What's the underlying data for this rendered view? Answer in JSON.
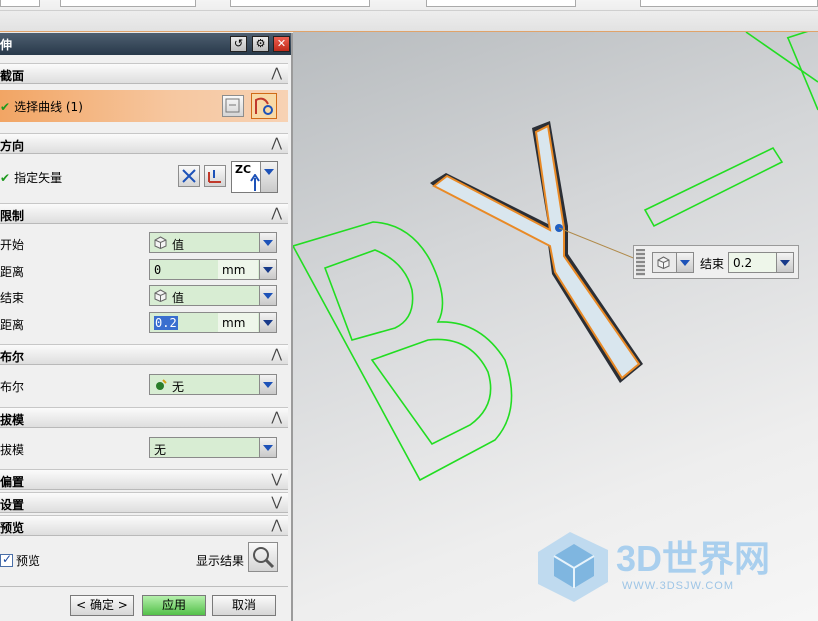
{
  "dialog": {
    "title": "伸",
    "sections": {
      "curve": {
        "label": "截面",
        "select_curve_label": "选择曲线 (1)"
      },
      "direction": {
        "label": "方向",
        "specify_vector_label": "指定矢量",
        "vector_option": "ZC"
      },
      "limits": {
        "label": "限制",
        "start_label": "开始",
        "start_value": "值",
        "start_distance_label": "距离",
        "start_distance": "0",
        "end_label": "结束",
        "end_value": "值",
        "end_distance_label": "距离",
        "end_distance": "0.2",
        "unit": "mm"
      },
      "boolean": {
        "label": "布尔",
        "field_label": "布尔",
        "value": "无"
      },
      "draft": {
        "label": "拔模",
        "field_label": "拔模",
        "value": "无"
      },
      "offset": {
        "label": "偏置"
      },
      "settings": {
        "label": "设置"
      },
      "preview": {
        "label": "预览",
        "preview_checkbox_label": "预览",
        "show_result_label": "显示结果"
      }
    },
    "buttons": {
      "ok": "< 确定 >",
      "apply": "应用",
      "cancel": "取消"
    }
  },
  "float_input": {
    "label": "结束",
    "value": "0.2"
  },
  "watermark": {
    "title": "3D世界网",
    "url": "WWW.3DSJW.COM"
  },
  "colors": {
    "curve": "#22dd22",
    "solid_outline": "#e98a26",
    "title_bar": "#34475a",
    "field_bg": "#d8edd3"
  }
}
